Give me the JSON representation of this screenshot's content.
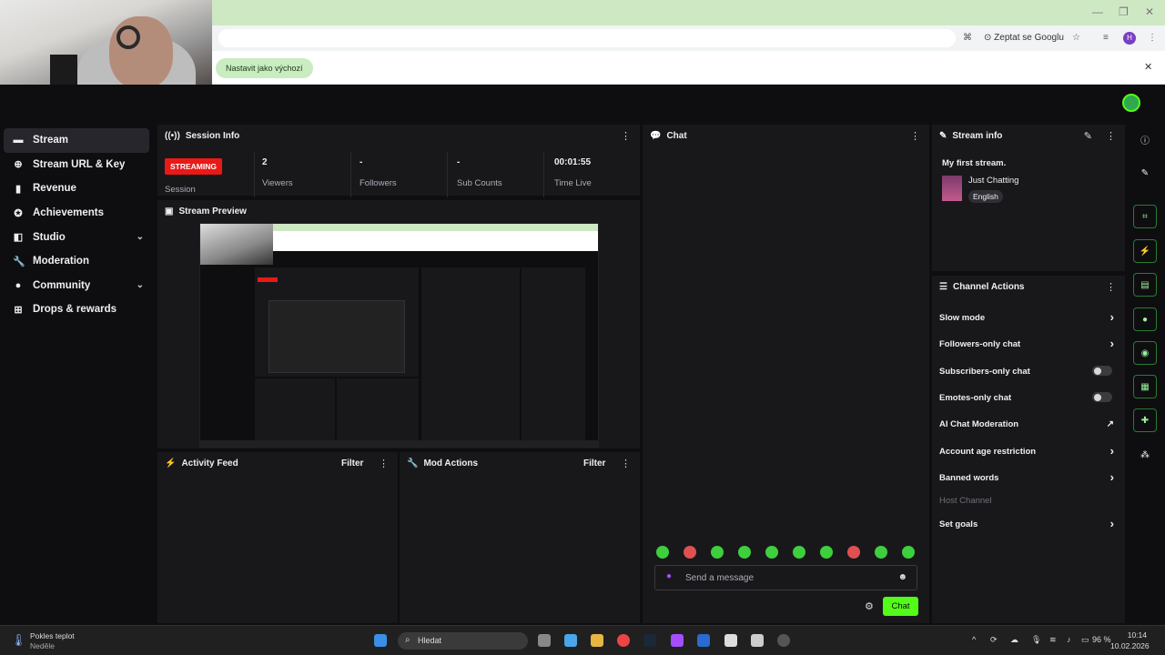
{
  "browser": {
    "translate_label": "Zeptat se Googlu",
    "profile_initial": "H",
    "infobar_chip": "Nastavit jako výchozí",
    "infobar_close": "✕"
  },
  "sidebar": {
    "items": [
      {
        "label": "Stream",
        "icon": "video-icon",
        "glyph": "▬"
      },
      {
        "label": "Stream URL & Key",
        "icon": "link-icon",
        "glyph": "⊕"
      },
      {
        "label": "Revenue",
        "icon": "chart-icon",
        "glyph": "▮"
      },
      {
        "label": "Achievements",
        "icon": "trophy-icon",
        "glyph": "✪"
      },
      {
        "label": "Studio",
        "icon": "studio-icon",
        "glyph": "◧",
        "chevron": "⌄"
      },
      {
        "label": "Moderation",
        "icon": "wrench-icon",
        "glyph": "🔧"
      },
      {
        "label": "Community",
        "icon": "people-icon",
        "glyph": "●",
        "chevron": "⌄"
      },
      {
        "label": "Drops & rewards",
        "icon": "gift-icon",
        "glyph": "⊞"
      }
    ]
  },
  "session": {
    "title": "Session Info",
    "badge": "STREAMING",
    "badge_sub": "Session",
    "stats": [
      {
        "value": "2",
        "label": "Viewers"
      },
      {
        "value": "-",
        "label": "Followers"
      },
      {
        "value": "-",
        "label": "Sub Counts"
      },
      {
        "value": "00:01:55",
        "label": "Time Live"
      }
    ]
  },
  "preview": {
    "title": "Stream Preview"
  },
  "activity": {
    "title": "Activity Feed",
    "filter": "Filter"
  },
  "mod": {
    "title": "Mod Actions",
    "filter": "Filter"
  },
  "chat": {
    "title": "Chat",
    "placeholder": "Send a message",
    "send_label": "Chat"
  },
  "stream_info": {
    "title": "Stream info",
    "stream_title": "My first stream.",
    "category": "Just Chatting",
    "language": "English"
  },
  "channel_actions": {
    "title": "Channel Actions",
    "items": [
      {
        "label": "Slow mode",
        "control": "chevron"
      },
      {
        "label": "Followers-only chat",
        "control": "chevron"
      },
      {
        "label": "Subscribers-only chat",
        "control": "toggle"
      },
      {
        "label": "Emotes-only chat",
        "control": "toggle"
      },
      {
        "label": "AI Chat Moderation",
        "control": "external"
      },
      {
        "label": "Account age restriction",
        "control": "chevron"
      },
      {
        "label": "Banned words",
        "control": "chevron"
      },
      {
        "label": "Host Channel",
        "control": "none"
      },
      {
        "label": "Set goals",
        "control": "chevron"
      }
    ]
  },
  "taskbar": {
    "weather_title": "Pokles teplot",
    "weather_sub": "Neděle",
    "search": "Hledat",
    "battery": "96 %",
    "time": "10:14",
    "date": "10.02.2026"
  },
  "colors": {
    "accent": "#53fc18",
    "live_red": "#e91916",
    "panel": "#18181b",
    "bg": "#0e0e10"
  }
}
